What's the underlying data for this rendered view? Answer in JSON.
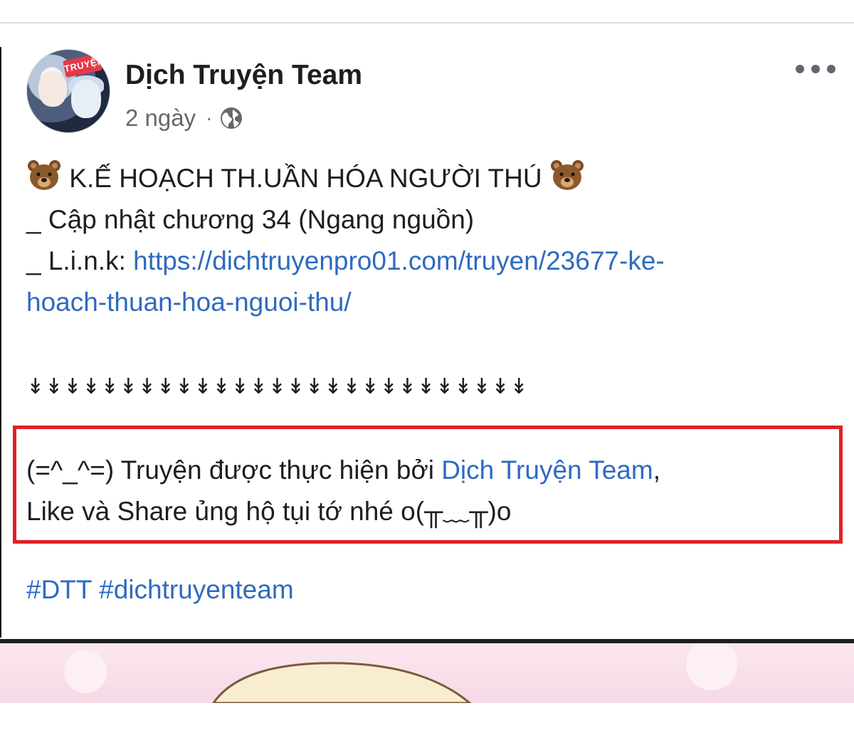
{
  "author": {
    "name": "Dịch Truyện Team",
    "avatar_badge": "TRUYỆN",
    "timestamp": "2 ngày",
    "separator": "·",
    "privacy_icon": "globe-icon"
  },
  "post": {
    "title": "K.Ế HOẠCH TH.UẦN HÓA NGƯỜI THÚ",
    "title_emoji": "bear-face-icon",
    "update_line": "_ Cập nhật chương 34 (Ngang nguồn)",
    "link_label": "_ L.i.n.k: ",
    "link_part1": "https://dichtruyenpro01.com/truyen/23677-ke-",
    "link_part2": "hoach-thuan-hoa-nguoi-thu/",
    "arrows": "↡↡↡↡↡↡↡↡↡↡↡↡↡↡↡↡↡↡↡↡↡↡↡↡↡↡↡",
    "credit_prefix": "(=^_^=) Truyện được thực hiện bởi ",
    "credit_link": "Dịch Truyện Team",
    "credit_suffix": ",",
    "credit_line2_text": "Like và Share ủng hộ tụi tớ nhé o(",
    "credit_line2_kaomoji": "╥﹏╥",
    "credit_line2_end": ")o",
    "hashtags": "#DTT #dichtruyenteam"
  },
  "colors": {
    "link": "#2f6ac0",
    "highlight_border": "#e02027",
    "secondary_text": "#65676b"
  },
  "icons": {
    "more": "more-options-icon"
  }
}
